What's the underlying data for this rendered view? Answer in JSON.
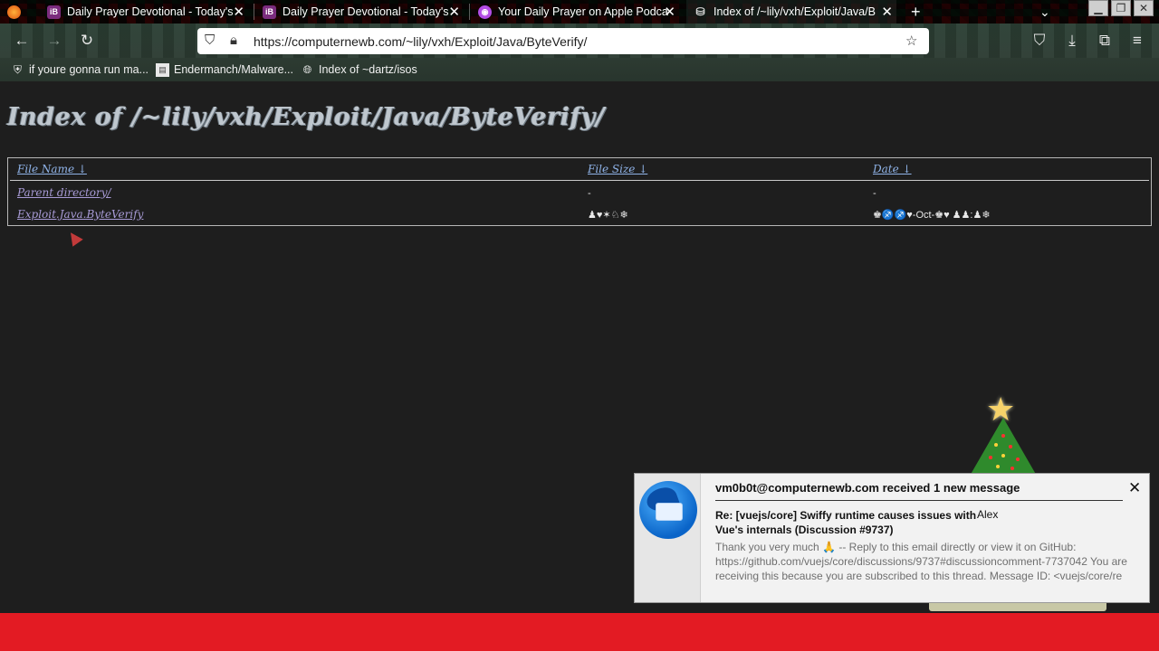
{
  "browser": {
    "tabs": [
      {
        "favicon": "iB",
        "favicon_color": "#7b2c7e",
        "title": "Daily Prayer Devotional - Today's"
      },
      {
        "favicon": "iB",
        "favicon_color": "#7b2c7e",
        "title": "Daily Prayer Devotional - Today's"
      },
      {
        "favicon": "podcast-icon",
        "favicon_color": "#b24ee6",
        "title": "Your Daily Prayer on Apple Podca"
      },
      {
        "favicon": "server-icon",
        "favicon_color": "#dddddd",
        "title": "Index of /~lily/vxh/Exploit/Java/B"
      }
    ],
    "new_tab_label": "+",
    "url": "https://computernewb.com/~lily/vxh/Exploit/Java/ByteVerify/",
    "bookmarks": [
      {
        "icon": "shield-avatar-icon",
        "label": "if youre gonna run ma..."
      },
      {
        "icon": "file-icon",
        "label": "Endermanch/Malware..."
      },
      {
        "icon": "globe-icon",
        "label": "Index of ~dartz/isos"
      }
    ]
  },
  "page": {
    "heading": "Index of /~lily/vxh/Exploit/Java/ByteVerify/",
    "columns": {
      "name": "File Name ↓",
      "size": "File Size ↓",
      "date": "Date ↓"
    },
    "rows": [
      {
        "name": "Parent directory/",
        "size": "-",
        "date": "-"
      },
      {
        "name": "Exploit.Java.ByteVerify",
        "size": "♟♥✶♘❄",
        "date": "♚♐♐♥-Oct-♚♥ ♟♟:♟❄"
      }
    ]
  },
  "notification": {
    "title": "vm0b0t@computernewb.com received 1 new message",
    "subject": "Re: [vuejs/core] Swiffy runtime causes issues with Vue's internals (Discussion #9737)",
    "sender": "Alex",
    "body": "Thank you very much 🙏 -- Reply to this email directly or view it on GitHub: https://github.com/vuejs/core/discussions/9737#discussioncomment-7737042 You are receiving this because you are subscribed to this thread. Message ID: <vuejs/core/re"
  },
  "colors": {
    "page_bg": "#1e1e1e",
    "link": "#8fb3e8",
    "visited_link": "#a89bd6",
    "taskbar": "#e31b23"
  }
}
